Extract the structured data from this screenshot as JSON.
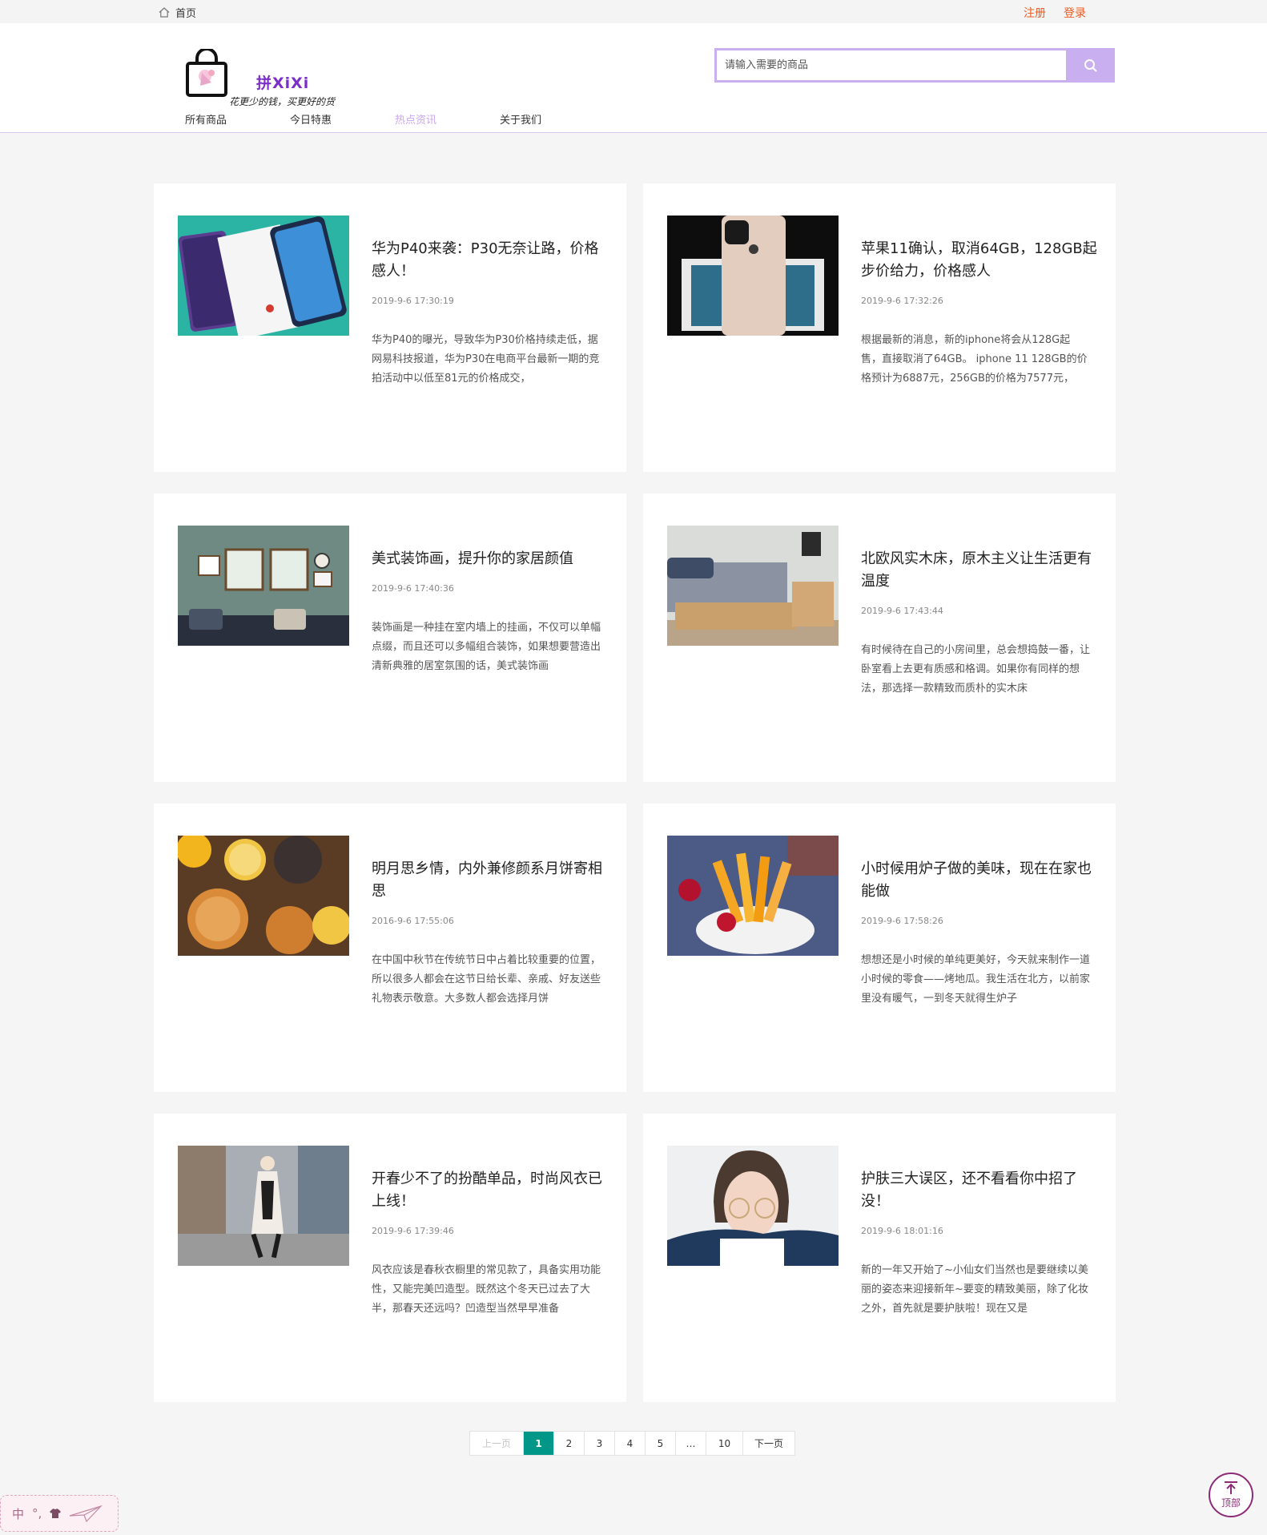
{
  "topbar": {
    "home_label": "首页",
    "register": "注册",
    "login": "登录"
  },
  "header": {
    "logo_brand": "拼XiXi",
    "logo_slogan": "花更少的钱，买更好的货",
    "search_placeholder": "请输入需要的商品",
    "nav": [
      "所有商品",
      "今日特惠",
      "热点资讯",
      "关于我们"
    ],
    "active_nav": "热点资讯"
  },
  "articles": [
    {
      "title": "华为P40来袭：P30无奈让路，价格感人！",
      "date": "2019-9-6 17:30:19",
      "desc": "华为P40的曝光，导致华为P30价格持续走低，据网易科技报道，华为P30在电商平台最新一期的竞拍活动中以低至81元的价格成交，",
      "image": "phone-huawei-p40"
    },
    {
      "title": "苹果11确认，取消64GB，128GB起步价给力，价格感人",
      "date": "2019-9-6 17:32:26",
      "desc": "根据最新的消息，新的iphone将会从128G起售，直接取消了64GB。 iphone 11 128GB的价格预计为6887元，256GB的价格为7577元，",
      "image": "phone-iphone-11"
    },
    {
      "title": "美式装饰画，提升你的家居颜值",
      "date": "2019-9-6 17:40:36",
      "desc": "装饰画是一种挂在室内墙上的挂画，不仅可以单幅点缀，而且还可以多幅组合装饰，如果想要营造出清新典雅的居室氛围的话，美式装饰画",
      "image": "living-room-wall-art"
    },
    {
      "title": "北欧风实木床，原木主义让生活更有温度",
      "date": "2019-9-6 17:43:44",
      "desc": "有时候待在自己的小房间里，总会想捣鼓一番，让卧室看上去更有质感和格调。如果你有同样的想法，那选择一款精致而质朴的实木床",
      "image": "wooden-bed"
    },
    {
      "title": "明月思乡情，内外兼修颜系月饼寄相思",
      "date": "2016-9-6 17:55:06",
      "desc": "在中国中秋节在传统节日中占着比较重要的位置，所以很多人都会在这节日给长辈、亲戚、好友送些礼物表示敬意。大多数人都会选择月饼",
      "image": "mooncakes-tea"
    },
    {
      "title": "小时候用炉子做的美味，现在在家也能做",
      "date": "2019-9-6 17:58:26",
      "desc": "想想还是小时候的单纯更美好，今天就来制作一道小时候的零食——烤地瓜。我生活在北方，以前家里没有暖气，一到冬天就得生炉子",
      "image": "sweet-potato-fries"
    },
    {
      "title": "开春少不了的扮酷单品，时尚风衣已上线！",
      "date": "2019-9-6 17:39:46",
      "desc": "风衣应该是春秋衣橱里的常见款了，具备实用功能性，又能完美凹造型。既然这个冬天已过去了大半，那春天还远吗？凹造型当然早早准备",
      "image": "woman-trench-coat-street"
    },
    {
      "title": "护肤三大误区，还不看看你中招了没！",
      "date": "2019-9-6 18:01:16",
      "desc": "新的一年又开始了~小仙女们当然也是要继续以美丽的姿态来迎接新年~要变的精致美丽，除了化妆之外，首先就是要护肤啦！现在又是",
      "image": "girl-with-glasses"
    }
  ],
  "pagination": {
    "prev": "上一页",
    "pages": [
      "1",
      "2",
      "3",
      "4",
      "5",
      "…",
      "10"
    ],
    "current": "1",
    "next": "下一页"
  },
  "back_to_top": "顶部",
  "ime": {
    "mode": "中",
    "punct": "°,"
  },
  "colors": {
    "accent": "#c9aff0",
    "auth_link": "#ee5b1e",
    "pager_current": "#009688",
    "back_top": "#8e2b77"
  }
}
